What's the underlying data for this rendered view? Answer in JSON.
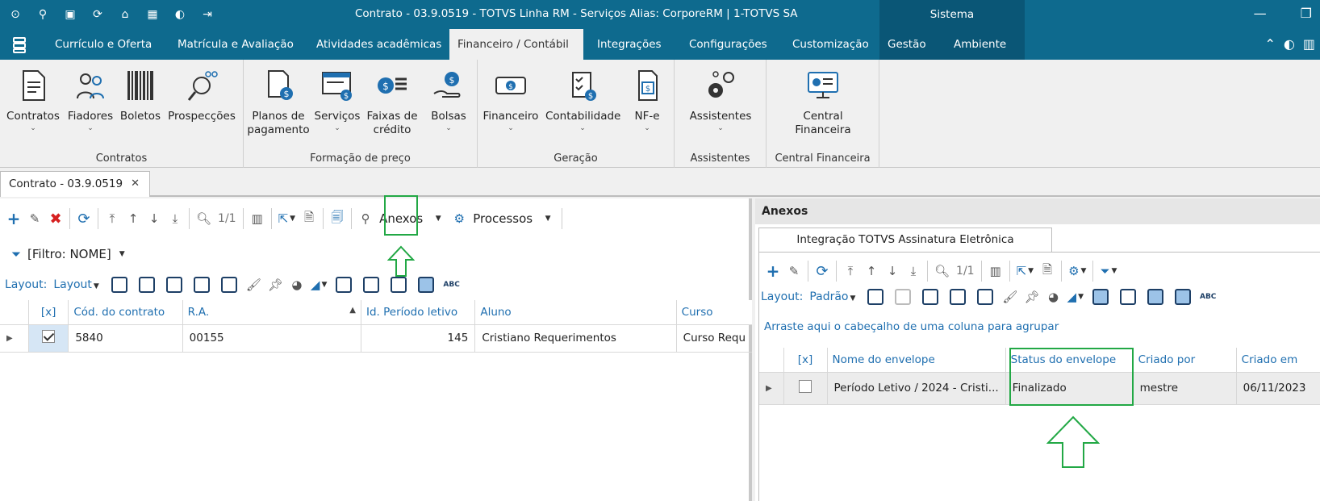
{
  "window": {
    "title": "Contrato - 03.9.0519 - TOTVS Linha RM - Serviços  Alias: CorporeRM | 1-TOTVS SA",
    "system_label": "Sistema"
  },
  "menu": {
    "tabs": [
      "Currículo e Oferta",
      "Matrícula e Avaliação",
      "Atividades acadêmicas",
      "Financeiro / Contábil",
      "Integrações",
      "Configurações",
      "Customização",
      "Gestão",
      "Ambiente"
    ],
    "active": "Financeiro / Contábil"
  },
  "ribbon": {
    "groups": [
      {
        "label": "Contratos",
        "buttons": [
          "Contratos",
          "Fiadores",
          "Boletos",
          "Prospecções"
        ]
      },
      {
        "label": "Formação de preço",
        "buttons": [
          "Planos de pagamento",
          "Serviços",
          "Faixas de crédito",
          "Bolsas"
        ]
      },
      {
        "label": "Geração",
        "buttons": [
          "Financeiro",
          "Contabilidade",
          "NF-e"
        ]
      },
      {
        "label": "Assistentes",
        "buttons": [
          "Assistentes"
        ]
      },
      {
        "label": "Central Financeira",
        "buttons": [
          "Central Financeira"
        ]
      }
    ],
    "btn_planos_1": "Planos de",
    "btn_planos_2": "pagamento",
    "btn_faixas_1": "Faixas de",
    "btn_faixas_2": "crédito",
    "btn_central_1": "Central",
    "btn_central_2": "Financeira"
  },
  "doc_tab": {
    "label": "Contrato - 03.9.0519"
  },
  "left": {
    "record_counter": "1/1",
    "anexos_label": "Anexos",
    "processos_label": "Processos",
    "filter_label": "[Filtro: NOME]",
    "layout_label": "Layout:",
    "layout_value": "Layout",
    "columns": [
      "[x]",
      "Cód. do contrato",
      "R.A.",
      "Id. Período letivo",
      "Aluno",
      "Curso"
    ],
    "rows": [
      {
        "cod": "5840",
        "ra": "00155",
        "periodo": "145",
        "aluno": "Cristiano Requerimentos",
        "curso": "Curso Requ"
      }
    ]
  },
  "right": {
    "header": "Anexos",
    "tab_label": "Integração TOTVS Assinatura Eletrônica",
    "record_counter": "1/1",
    "layout_label": "Layout:",
    "layout_value": "Padrão",
    "group_hint": "Arraste aqui o cabeçalho de uma coluna para agrupar",
    "columns": [
      "[x]",
      "Nome do envelope",
      "Status do envelope",
      "Criado por",
      "Criado em"
    ],
    "rows": [
      {
        "nome": "Período Letivo / 2024 - Cristi...",
        "status": "Finalizado",
        "criado_por": "mestre",
        "criado_em": "06/11/2023"
      }
    ]
  },
  "colors": {
    "titlebar": "#0e6a8e",
    "accent_blue": "#1f6fb0",
    "annotation_green": "#22a845"
  }
}
